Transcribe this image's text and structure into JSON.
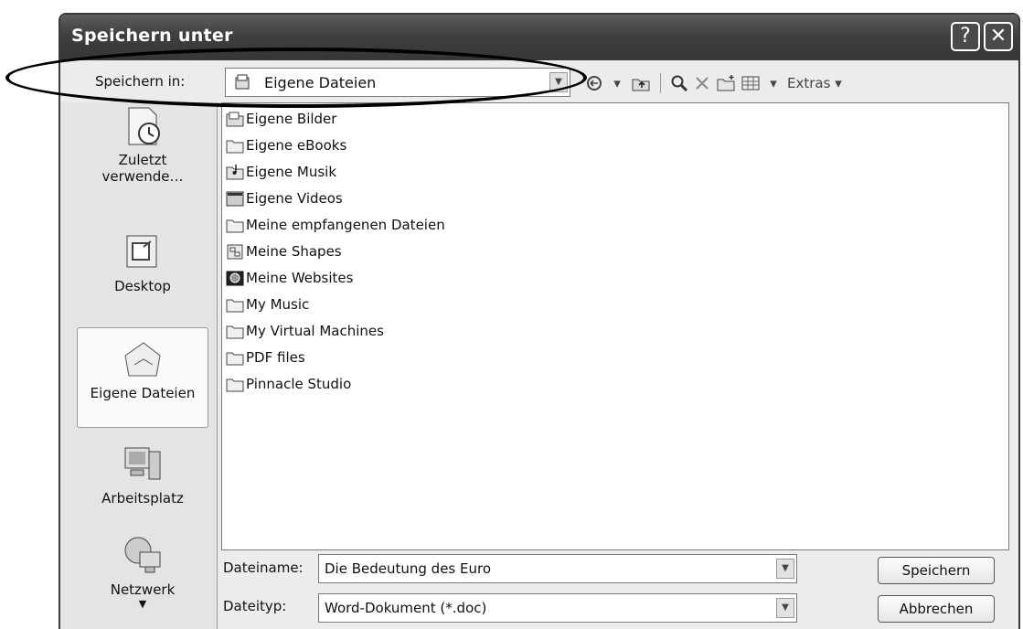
{
  "window": {
    "title": "Speichern unter",
    "help_glyph": "?",
    "close_glyph": "✕"
  },
  "save_in": {
    "label": "Speichern in:",
    "value": "Eigene Dateien"
  },
  "toolbar": {
    "extras_label": "Extras",
    "icons": [
      "back-icon",
      "up-folder-icon",
      "search-web-icon",
      "delete-icon",
      "new-folder-icon",
      "views-icon"
    ]
  },
  "places": [
    {
      "label": "Zuletzt verwende…",
      "icon": "recent-icon"
    },
    {
      "label": "Desktop",
      "icon": "desktop-icon"
    },
    {
      "label": "Eigene Dateien",
      "icon": "my-documents-icon",
      "selected": true
    },
    {
      "label": "Arbeitsplatz",
      "icon": "my-computer-icon"
    },
    {
      "label": "Netzwerk",
      "icon": "network-icon"
    }
  ],
  "files": [
    {
      "name": "Eigene Bilder",
      "icon": "pictures-folder-icon"
    },
    {
      "name": "Eigene eBooks",
      "icon": "folder-icon"
    },
    {
      "name": "Eigene Musik",
      "icon": "music-folder-icon"
    },
    {
      "name": "Eigene Videos",
      "icon": "video-folder-icon"
    },
    {
      "name": "Meine empfangenen Dateien",
      "icon": "folder-icon"
    },
    {
      "name": "Meine Shapes",
      "icon": "shapes-folder-icon"
    },
    {
      "name": "Meine Websites",
      "icon": "websites-folder-icon"
    },
    {
      "name": "My Music",
      "icon": "folder-icon"
    },
    {
      "name": "My Virtual Machines",
      "icon": "folder-icon"
    },
    {
      "name": "PDF files",
      "icon": "folder-icon"
    },
    {
      "name": "Pinnacle Studio",
      "icon": "folder-icon"
    }
  ],
  "filename": {
    "label": "Dateiname:",
    "value": "Die Bedeutung des Euro"
  },
  "filetype": {
    "label": "Dateityp:",
    "value": "Word-Dokument (*.doc)"
  },
  "buttons": {
    "save": "Speichern",
    "cancel": "Abbrechen"
  }
}
